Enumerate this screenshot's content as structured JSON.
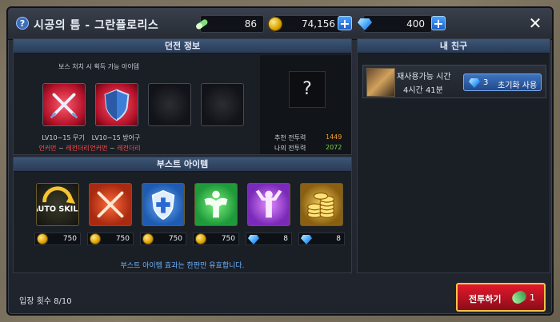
{
  "window": {
    "title": "시공의 틈 - 그란플로리스"
  },
  "currencies": [
    {
      "icon": "energy-potion-icon",
      "value": "86"
    },
    {
      "icon": "gold-coin-icon",
      "value": "74,156"
    },
    {
      "icon": "gem-icon",
      "value": "400"
    }
  ],
  "dungeon": {
    "header": "던전 정보",
    "subtitle": "보스 처치 시 획득 가능 아이템",
    "items": [
      {
        "icon": "crossed-swords-icon",
        "label": "LV10~15 무기",
        "rarity_from": "언커먼",
        "rarity_to": "레전더리"
      },
      {
        "icon": "shield-icon",
        "label": "LV10~15 방어구",
        "rarity_from": "언커먼",
        "rarity_to": "레전더리"
      }
    ],
    "unknown": "?",
    "recommended_label": "추천 전투력",
    "recommended_value": "1449",
    "my_label": "나의 전투력",
    "my_value": "2072"
  },
  "boost": {
    "header": "부스트 아이템",
    "items": [
      {
        "icon": "auto-skill-icon",
        "text": "AUTO SKILL",
        "currency": "gold",
        "price": "750"
      },
      {
        "icon": "crossed-swords-boost-icon",
        "currency": "gold",
        "price": "750"
      },
      {
        "icon": "shield-boost-icon",
        "currency": "gold",
        "price": "750"
      },
      {
        "icon": "muscle-boost-icon",
        "currency": "gold",
        "price": "750"
      },
      {
        "icon": "power-pose-boost-icon",
        "currency": "gem",
        "price": "8"
      },
      {
        "icon": "gold-stack-boost-icon",
        "currency": "gem",
        "price": "8"
      }
    ],
    "note": "부스트 아이템 효과는 한판만 유효합니다."
  },
  "friends": {
    "header": "내 친구",
    "reuse_label": "재사용가능 시간",
    "reuse_time": "4시간 41분",
    "reset_cost": "3",
    "reset_label": "초기화 사용"
  },
  "footer": {
    "entry_count": "입장 횟수 8/10",
    "battle_label": "전투하기",
    "battle_cost": "1"
  },
  "colors": {
    "accent_red": "#e3182d",
    "note_blue": "#6fb4ff",
    "recommended": "#f0a030",
    "mine": "#7ed04a"
  }
}
